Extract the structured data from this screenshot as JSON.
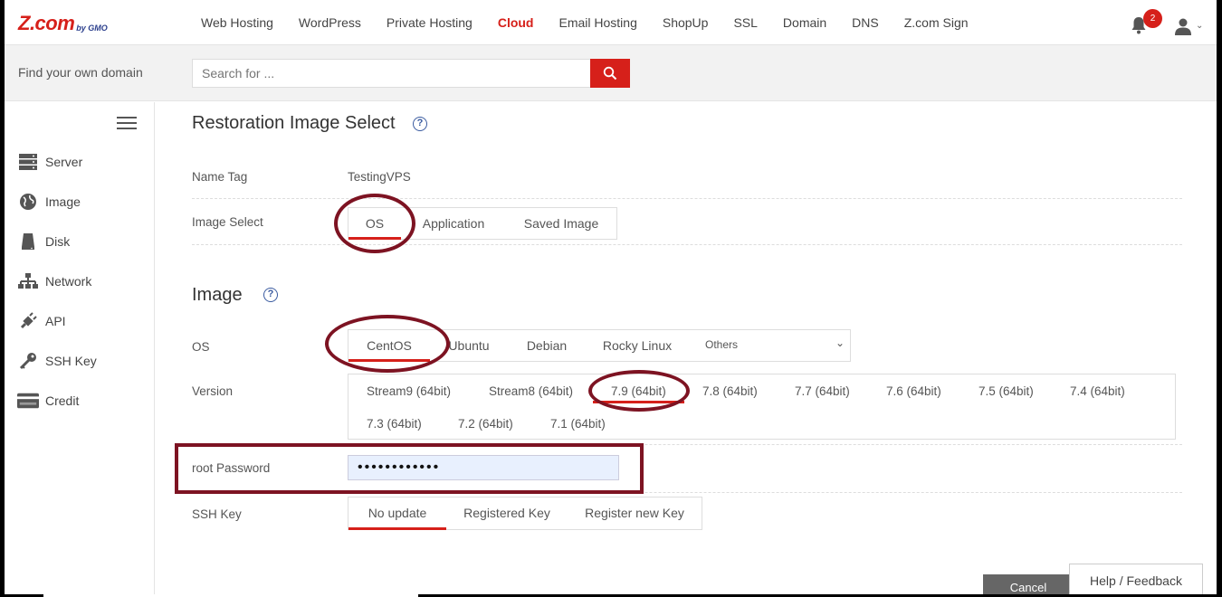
{
  "brand": {
    "logo_main": "Z.com",
    "logo_sub": "by GMO"
  },
  "nav": {
    "links": [
      "Web Hosting",
      "WordPress",
      "Private Hosting",
      "Cloud",
      "Email Hosting",
      "ShopUp",
      "SSL",
      "Domain",
      "DNS",
      "Z.com Sign"
    ],
    "active": "Cloud",
    "notification_count": "2"
  },
  "search": {
    "label": "Find your own domain",
    "placeholder": "Search for ..."
  },
  "sidebar": {
    "items": [
      {
        "label": "Server",
        "icon": "server-icon"
      },
      {
        "label": "Image",
        "icon": "globe-icon"
      },
      {
        "label": "Disk",
        "icon": "disk-icon"
      },
      {
        "label": "Network",
        "icon": "network-icon"
      },
      {
        "label": "API",
        "icon": "plug-icon"
      },
      {
        "label": "SSH Key",
        "icon": "key-icon"
      },
      {
        "label": "Credit",
        "icon": "credit-card-icon"
      }
    ]
  },
  "restore": {
    "title": "Restoration Image Select",
    "name_tag_label": "Name Tag",
    "name_tag_value": "TestingVPS",
    "image_select_label": "Image Select",
    "image_select_tabs": [
      "OS",
      "Application",
      "Saved Image"
    ],
    "image_select_active": "OS"
  },
  "image": {
    "title": "Image",
    "os_label": "OS",
    "os_tabs": [
      "CentOS",
      "Ubuntu",
      "Debian",
      "Rocky Linux"
    ],
    "os_active": "CentOS",
    "os_others": "Others",
    "version_label": "Version",
    "versions": [
      "Stream9 (64bit)",
      "Stream8 (64bit)",
      "7.9 (64bit)",
      "7.8 (64bit)",
      "7.7 (64bit)",
      "7.6 (64bit)",
      "7.5 (64bit)",
      "7.4 (64bit)",
      "7.3 (64bit)",
      "7.2 (64bit)",
      "7.1 (64bit)"
    ],
    "version_active": "7.9 (64bit)",
    "root_password_label": "root Password",
    "root_password_value": "••••••••••••",
    "ssh_key_label": "SSH Key",
    "ssh_key_tabs": [
      "No update",
      "Registered Key",
      "Register new Key"
    ],
    "ssh_key_active": "No update"
  },
  "footer": {
    "cancel": "Cancel",
    "help_feedback": "Help / Feedback"
  },
  "colors": {
    "accent": "#d6201a",
    "annotation": "#7d1322",
    "help": "#3a5ba0"
  }
}
